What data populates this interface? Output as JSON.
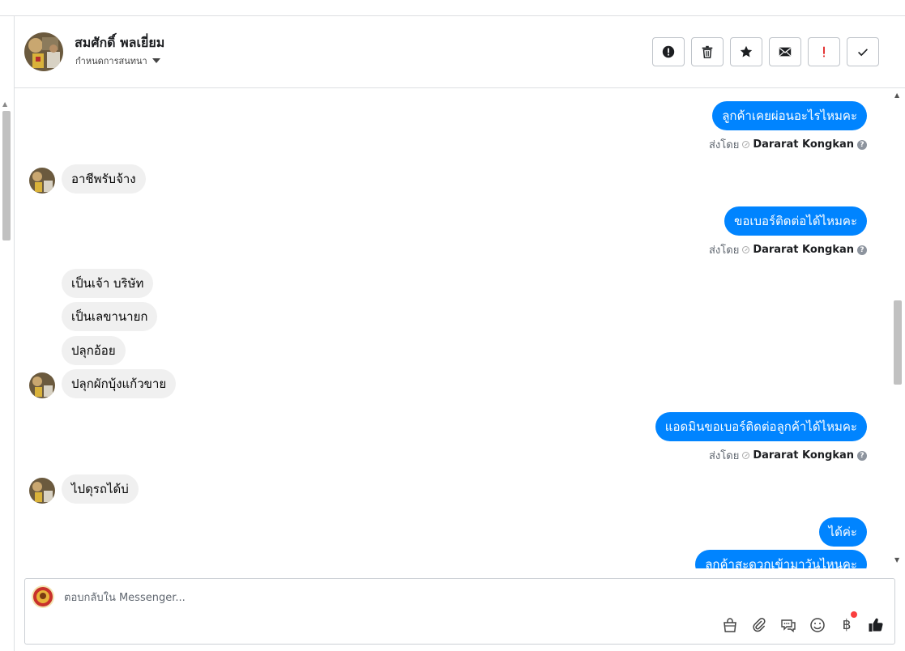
{
  "header": {
    "name": "สมศักดิ์ พลเยี่ยม",
    "assign_label": "กำหนดการสนทนา"
  },
  "toolbar": {
    "buttons": [
      {
        "name": "spam-button",
        "icon": "alert-circle-icon"
      },
      {
        "name": "delete-button",
        "icon": "trash-icon"
      },
      {
        "name": "star-button",
        "icon": "star-icon"
      },
      {
        "name": "mark-unread-button",
        "icon": "envelope-icon"
      },
      {
        "name": "follow-up-button",
        "icon": "exclamation-icon"
      },
      {
        "name": "mark-done-button",
        "icon": "check-icon"
      }
    ]
  },
  "sent_by": {
    "prefix": "ส่งโดย",
    "agent": "Dararat Kongkan"
  },
  "messages": {
    "m1": "ลูกค้าเคยผ่อนอะไรไหมคะ",
    "m2": "อาชีพรับจ้าง",
    "m3": "ขอเบอร์ติดต่อได้ไหมคะ",
    "m4": "เป็นเจ้า บริษัท",
    "m5": "เป็นเลขานายก",
    "m6": "ปลุกอ้อย",
    "m7": "ปลุกผักบุ้งแก้วขาย",
    "m8": "แอดมินขอเบอร์ติดต่อลูกค้าได้ไหมคะ",
    "m9": "ไปดุรถได้บ่",
    "m10": "ได้ค่ะ",
    "m11": "ลูกค้าสะดวกเข้ามาวันไหนคะ"
  },
  "composer": {
    "placeholder": "ตอบกลับใน Messenger..."
  },
  "colors": {
    "outgoing_bubble": "#0084ff",
    "incoming_bubble": "#f0f0f0"
  }
}
